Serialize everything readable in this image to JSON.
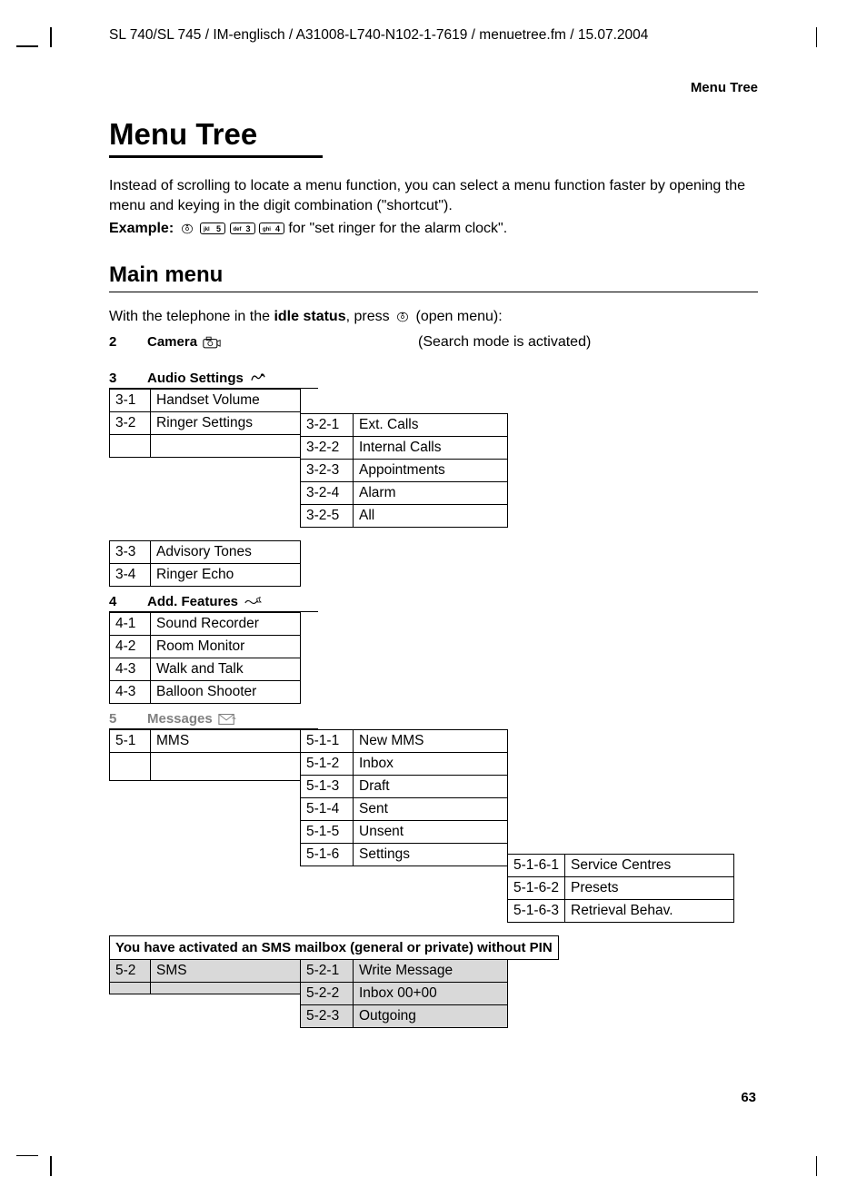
{
  "filePath": "SL 740/SL 745 / IM-englisch / A31008-L740-N102-1-7619 / menuetree.fm / 15.07.2004",
  "headerRight": "Menu Tree",
  "title": "Menu Tree",
  "intro": "Instead of scrolling to locate a menu function, you can select a menu function faster by opening the menu and keying in the digit combination (\"shortcut\").",
  "exampleLabel": "Example:",
  "exampleKeys": [
    "5",
    "3",
    "4"
  ],
  "exampleKeyLetters": [
    "jkl",
    "def",
    "ghi"
  ],
  "exampleText": " for \"set ringer for the alarm clock\".",
  "mainMenuHeading": "Main menu",
  "idlePrefix": "With the telephone in the ",
  "idleBold": "idle status",
  "idleSuffix": ", press ",
  "idleAfter": " (open menu):",
  "sections": {
    "s2": {
      "num": "2",
      "title": "Camera",
      "note": "(Search mode is activated)"
    },
    "s3": {
      "num": "3",
      "title": "Audio Settings"
    },
    "s4": {
      "num": "4",
      "title": "Add. Features"
    },
    "s5": {
      "num": "5",
      "title": "Messages"
    }
  },
  "audio": {
    "r1": {
      "c": "3-1",
      "l": "Handset Volume"
    },
    "r2": {
      "c": "3-2",
      "l": "Ringer Settings"
    },
    "r3": {
      "c": "3-3",
      "l": "Advisory Tones"
    },
    "r4": {
      "c": "3-4",
      "l": "Ringer Echo"
    },
    "sub": {
      "r1": {
        "c": "3-2-1",
        "l": "Ext. Calls"
      },
      "r2": {
        "c": "3-2-2",
        "l": "Internal Calls"
      },
      "r3": {
        "c": "3-2-3",
        "l": "Appointments"
      },
      "r4": {
        "c": "3-2-4",
        "l": "Alarm"
      },
      "r5": {
        "c": "3-2-5",
        "l": "All"
      }
    }
  },
  "addFeatures": {
    "r1": {
      "c": "4-1",
      "l": "Sound Recorder"
    },
    "r2": {
      "c": "4-2",
      "l": "Room Monitor"
    },
    "r3": {
      "c": "4-3",
      "l": "Walk and Talk"
    },
    "r4": {
      "c": "4-3",
      "l": "Balloon Shooter"
    }
  },
  "messages": {
    "r1": {
      "c": "5-1",
      "l": "MMS"
    },
    "sub": {
      "r1": {
        "c": "5-1-1",
        "l": "New MMS"
      },
      "r2": {
        "c": "5-1-2",
        "l": "Inbox"
      },
      "r3": {
        "c": "5-1-3",
        "l": "Draft"
      },
      "r4": {
        "c": "5-1-4",
        "l": "Sent"
      },
      "r5": {
        "c": "5-1-5",
        "l": "Unsent"
      },
      "r6": {
        "c": "5-1-6",
        "l": "Settings"
      }
    },
    "subsub": {
      "r1": {
        "c": "5-1-6-1",
        "l": "Service Centres"
      },
      "r2": {
        "c": "5-1-6-2",
        "l": "Presets"
      },
      "r3": {
        "c": "5-1-6-3",
        "l": "Retrieval Behav."
      }
    }
  },
  "smsNote": "You have activated an SMS mailbox (general or private) without PIN",
  "sms": {
    "r1": {
      "c": "5-2",
      "l": "SMS"
    },
    "sub": {
      "r1": {
        "c": "5-2-1",
        "l": "Write Message"
      },
      "r2": {
        "c": "5-2-2",
        "l": "Inbox 00+00"
      },
      "r3": {
        "c": "5-2-3",
        "l": "Outgoing"
      }
    }
  },
  "pageNum": "63"
}
